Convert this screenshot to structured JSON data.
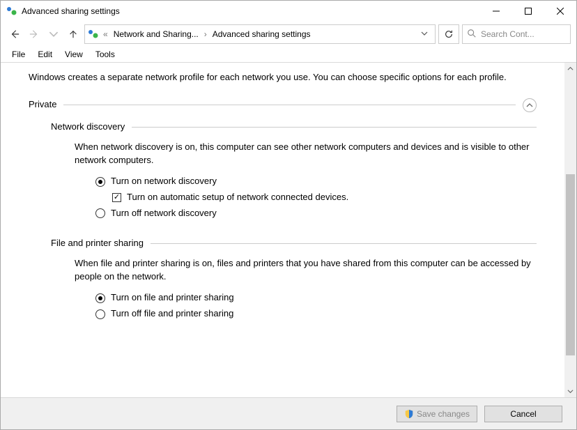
{
  "window": {
    "title": "Advanced sharing settings"
  },
  "nav": {
    "breadcrumb1": "Network and Sharing...",
    "breadcrumb2": "Advanced sharing settings",
    "search_placeholder": "Search Cont..."
  },
  "menu": {
    "file": "File",
    "edit": "Edit",
    "view": "View",
    "tools": "Tools"
  },
  "intro": "Windows creates a separate network profile for each network you use. You can choose specific options for each profile.",
  "sections": {
    "private": {
      "label": "Private",
      "network_discovery": {
        "label": "Network discovery",
        "desc": "When network discovery is on, this computer can see other network computers and devices and is visible to other network computers.",
        "opt_on": "Turn on network discovery",
        "opt_auto": "Turn on automatic setup of network connected devices.",
        "opt_off": "Turn off network discovery"
      },
      "file_printer": {
        "label": "File and printer sharing",
        "desc": "When file and printer sharing is on, files and printers that you have shared from this computer can be accessed by people on the network.",
        "opt_on": "Turn on file and printer sharing",
        "opt_off": "Turn off file and printer sharing"
      }
    }
  },
  "footer": {
    "save": "Save changes",
    "cancel": "Cancel"
  }
}
